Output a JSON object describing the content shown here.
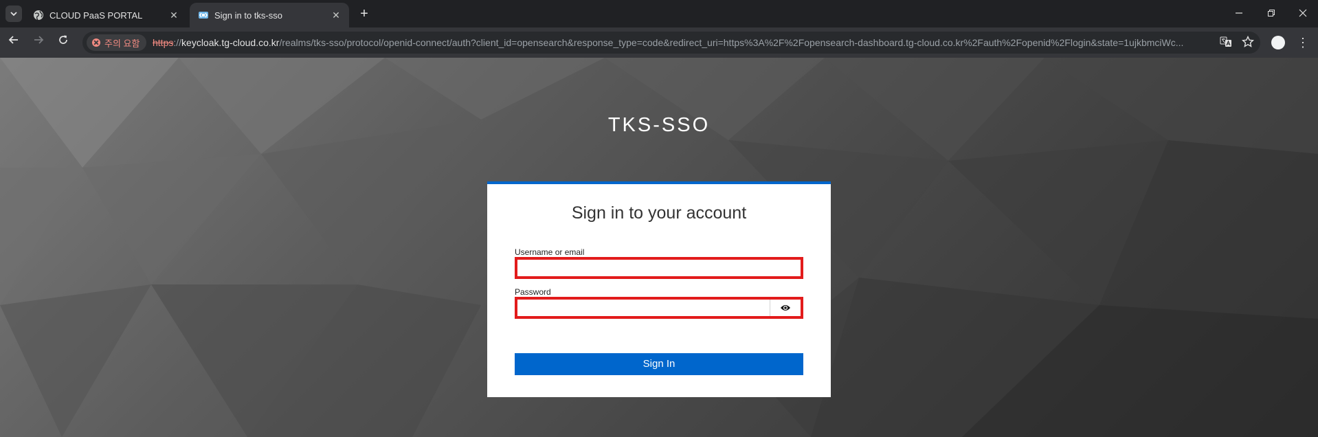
{
  "browser": {
    "tabs": [
      {
        "title": "CLOUD PaaS PORTAL",
        "active": false,
        "icon": "globe-icon"
      },
      {
        "title": "Sign in to tks-sso",
        "active": true,
        "icon": "keycloak-icon"
      }
    ],
    "new_tab_label": "+",
    "security_chip": "주의 요함",
    "url": {
      "scheme": "https",
      "host": "keycloak.tg-cloud.co.kr",
      "path": "/realms/tks-sso/protocol/openid-connect/auth?client_id=opensearch&response_type=code&redirect_uri=https%3A%2F%2Fopensearch-dashboard.tg-cloud.co.kr%2Fauth%2Fopenid%2Flogin&state=1ujkbmciWc..."
    }
  },
  "page": {
    "realm_title": "TKS-SSO",
    "card_title": "Sign in to your account",
    "username_label": "Username or email",
    "username_value": "",
    "password_label": "Password",
    "password_value": "",
    "submit_label": "Sign In"
  },
  "colors": {
    "accent": "#0066cc",
    "highlight_border": "#e21b1b",
    "warning": "#f28b82"
  }
}
